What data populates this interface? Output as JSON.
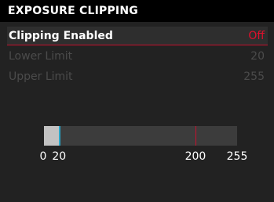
{
  "header": {
    "title": "EXPOSURE CLIPPING"
  },
  "menu": {
    "items": [
      {
        "label": "Clipping Enabled",
        "value": "Off"
      },
      {
        "label": "Lower Limit",
        "value": "20"
      },
      {
        "label": "Upper Limit",
        "value": "255"
      }
    ]
  },
  "slider": {
    "min": 0,
    "max": 255,
    "lower": 20,
    "upper": 200,
    "tick_labels": [
      "0",
      "20",
      "200",
      "255"
    ],
    "colors": {
      "lower_marker": "#2aa7c9",
      "upper_marker": "#c8102e",
      "accent": "#e0102c"
    }
  }
}
